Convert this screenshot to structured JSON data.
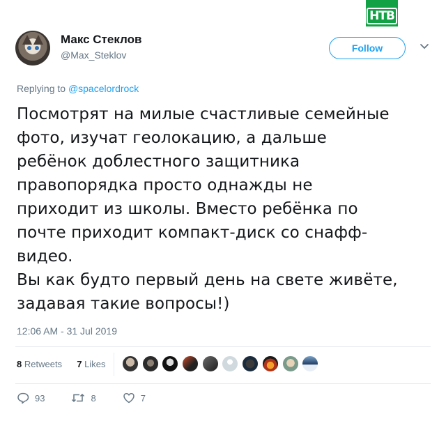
{
  "overlay": {
    "logo_text": "НТВ",
    "logo_color": "#12a144"
  },
  "tweet": {
    "author_name": "Макс Стеклов",
    "author_handle": "@Max_Steklov",
    "follow_label": "Follow",
    "reply_prefix": "Replying to",
    "reply_handle": "@spacelordrock",
    "lines": [
      "Посмотрят на милые счастливые семейные",
      "фото, изучат геолокацию, а дальше",
      "ребёнок доблестного защитника",
      "правопорядка просто однажды не",
      "приходит из школы. Вместо ребёнка по",
      "почте приходит компакт-диск со снафф-",
      "видео.",
      "Вы как будто первый день на свете живёте,",
      "задавая такие вопросы!)"
    ],
    "timestamp": "12:06 AM - 31 Jul 2019",
    "retweets_count": "8",
    "retweets_label": "Retweets",
    "likes_count": "7",
    "likes_label": "Likes",
    "likers_icons": [
      "liker-avatar",
      "liker-avatar",
      "liker-avatar",
      "liker-avatar",
      "liker-avatar",
      "liker-avatar",
      "liker-avatar",
      "liker-avatar",
      "liker-avatar",
      "liker-avatar"
    ],
    "actions": {
      "replies": "93",
      "retweets": "8",
      "likes": "7"
    },
    "accent_color": "#1da1f2"
  }
}
